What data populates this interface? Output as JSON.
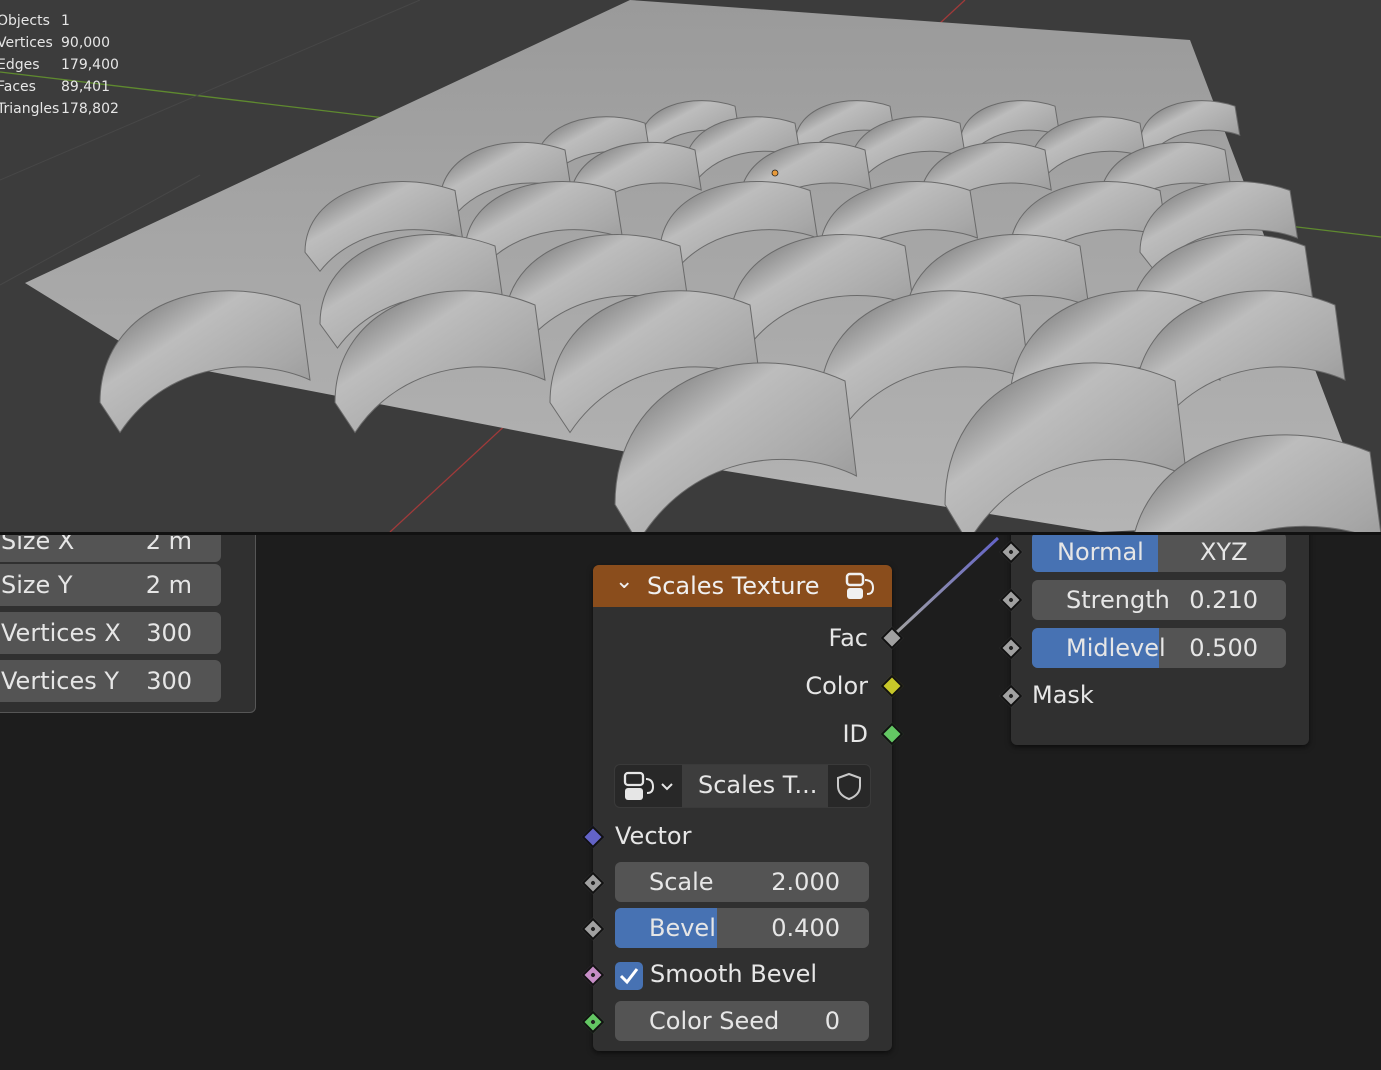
{
  "viewport": {
    "stats": [
      {
        "label": "Objects",
        "value": "1"
      },
      {
        "label": "Vertices",
        "value": "90,000"
      },
      {
        "label": "Edges",
        "value": "179,400"
      },
      {
        "label": "Faces",
        "value": "89,401"
      },
      {
        "label": "Triangles",
        "value": "178,802"
      }
    ]
  },
  "grid_panel": {
    "fields": [
      {
        "label": "Size X",
        "value": "2 m"
      },
      {
        "label": "Size Y",
        "value": "2 m"
      },
      {
        "label": "Vertices X",
        "value": "300"
      },
      {
        "label": "Vertices Y",
        "value": "300"
      }
    ]
  },
  "scales_node": {
    "title": "Scales Texture",
    "header_color": "#8a4d1c",
    "outputs": [
      {
        "label": "Fac",
        "color": "#a1a1a1"
      },
      {
        "label": "Color",
        "color": "#c7c729"
      },
      {
        "label": "ID",
        "color": "#63c763"
      }
    ],
    "texture_name": "Scales T...",
    "inputs": {
      "vector": "Vector",
      "scale": {
        "label": "Scale",
        "value": "2.000"
      },
      "bevel": {
        "label": "Bevel",
        "value": "0.400",
        "fill": 0.4
      },
      "smooth_bevel": {
        "label": "Smooth Bevel",
        "checked": true
      },
      "color_seed": {
        "label": "Color Seed",
        "value": "0"
      }
    }
  },
  "displacement_node": {
    "space": {
      "selected": "Normal",
      "other": "XYZ"
    },
    "strength": {
      "label": "Strength",
      "value": "0.210"
    },
    "midlevel": {
      "label": "Midlevel",
      "value": "0.500",
      "fill": 0.5
    },
    "mask": "Mask"
  },
  "colors": {
    "accent": "#4772b3",
    "node_bg": "#303030",
    "field_bg": "#545454",
    "vector_socket": "#6363c7",
    "shader_socket": "#c78ec7"
  }
}
